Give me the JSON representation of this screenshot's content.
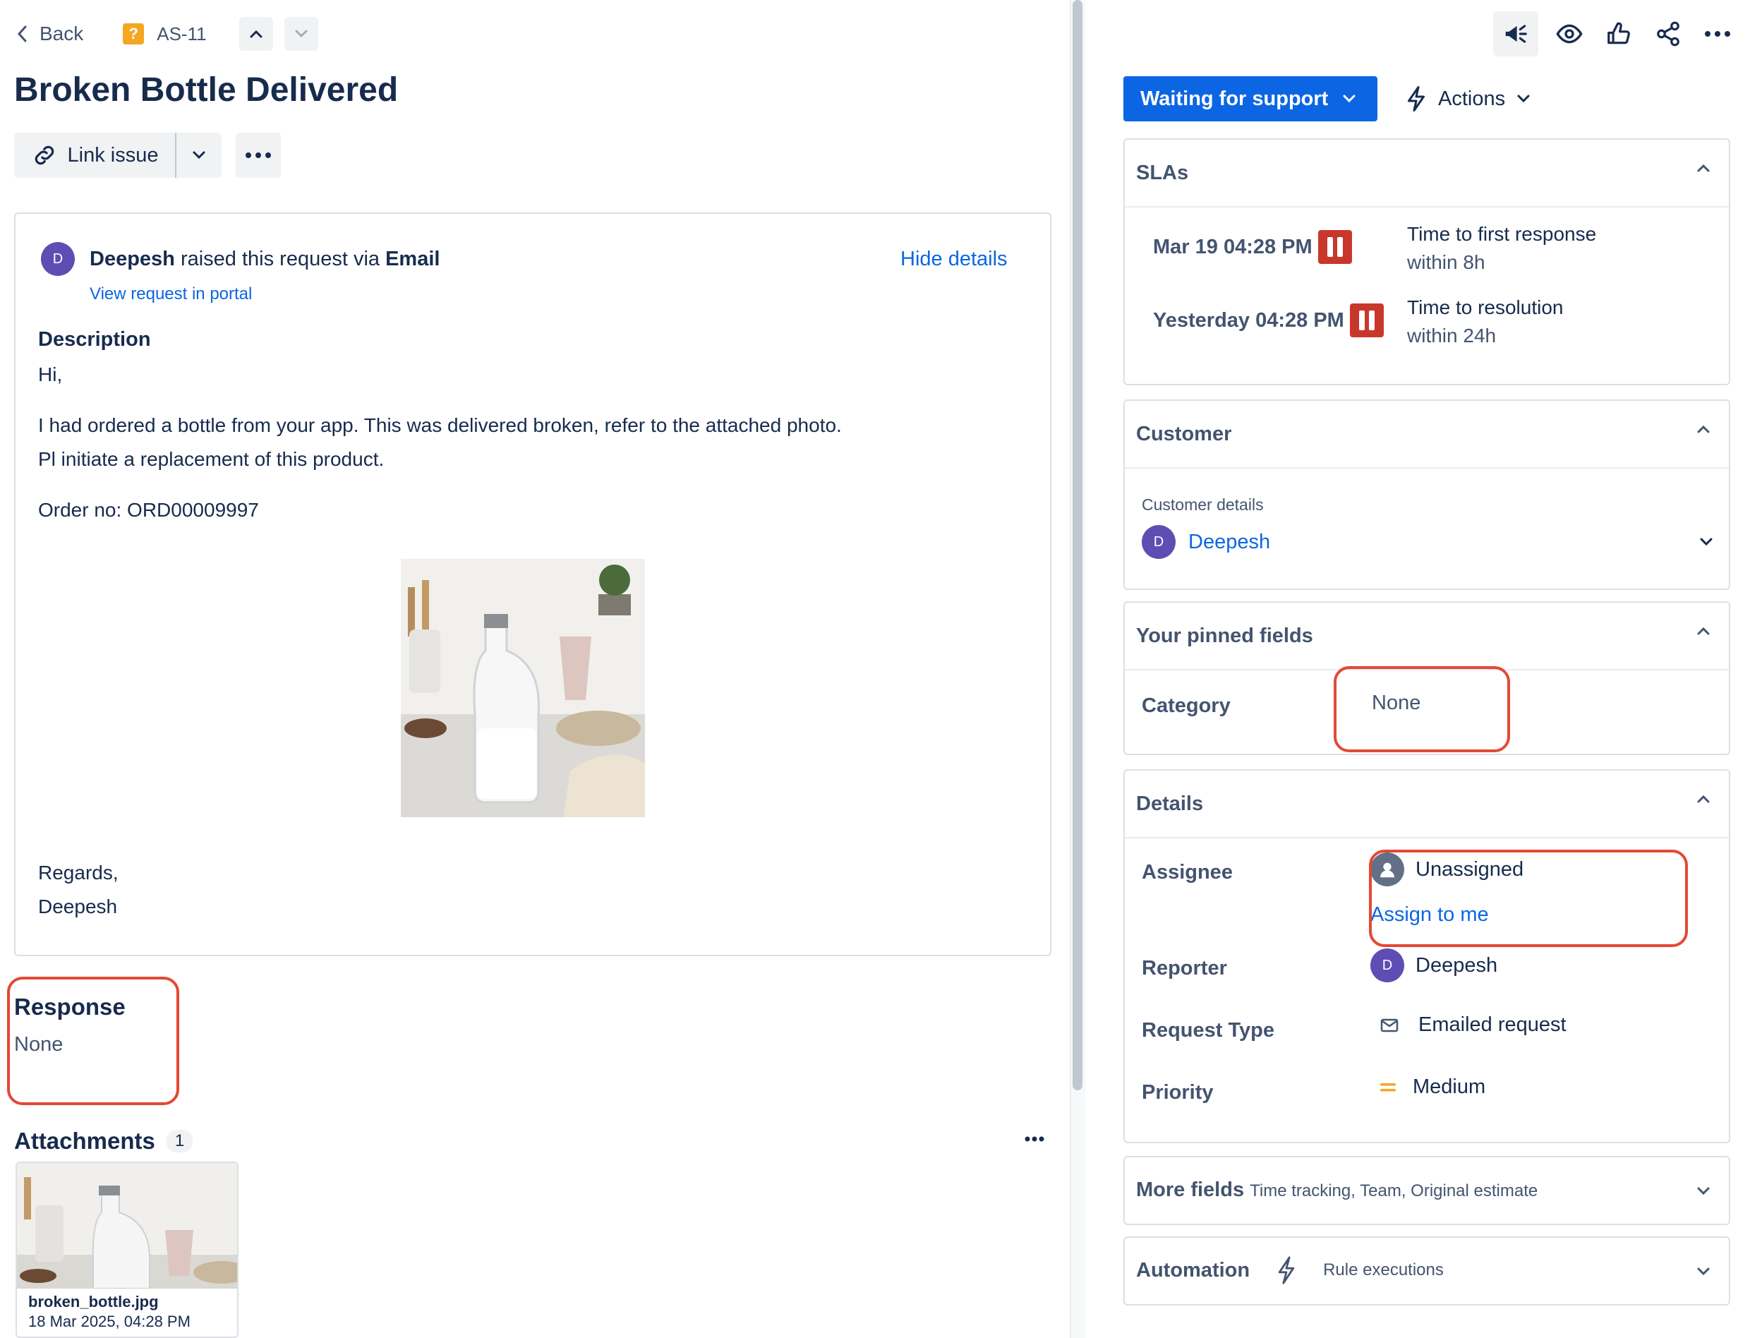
{
  "header": {
    "back_label": "Back",
    "issue_key": "AS-11"
  },
  "title": "Broken Bottle Delivered",
  "toolbar": {
    "link_issue_label": "Link issue"
  },
  "request": {
    "avatar_initial": "D",
    "raiser": "Deepesh",
    "raised_text": " raised this request via ",
    "channel": "Email",
    "hide_details": "Hide details",
    "view_portal": "View request in portal",
    "description_label": "Description",
    "lines": [
      "Hi,",
      "I had ordered a bottle from your app. This was delivered broken, refer to the attached photo.",
      "Pl initiate a replacement of this product.",
      "Order no: ORD00009997",
      "Regards,",
      "Deepesh"
    ]
  },
  "response": {
    "label": "Response",
    "value": "None"
  },
  "attachments": {
    "label": "Attachments",
    "count": "1",
    "items": [
      {
        "name": "broken_bottle.jpg",
        "date": "18 Mar 2025, 04:28 PM"
      }
    ]
  },
  "status": {
    "label": "Waiting for support",
    "actions_label": "Actions"
  },
  "slas": {
    "label": "SLAs",
    "items": [
      {
        "time": "Mar 19 04:28 PM",
        "name": "Time to first response",
        "target": "within 8h"
      },
      {
        "time": "Yesterday 04:28 PM",
        "name": "Time to resolution",
        "target": "within 24h"
      }
    ]
  },
  "customer": {
    "label": "Customer",
    "sublabel": "Customer details",
    "name": "Deepesh",
    "avatar_initial": "D"
  },
  "pinned": {
    "label": "Your pinned fields",
    "category_label": "Category",
    "category_value": "None"
  },
  "details": {
    "label": "Details",
    "assignee_label": "Assignee",
    "assignee_value": "Unassigned",
    "assign_to_me": "Assign to me",
    "reporter_label": "Reporter",
    "reporter_value": "Deepesh",
    "reporter_initial": "D",
    "request_type_label": "Request Type",
    "request_type_value": "Emailed request",
    "priority_label": "Priority",
    "priority_value": "Medium"
  },
  "more_fields": {
    "label": "More fields",
    "sub": "Time tracking, Team, Original estimate"
  },
  "automation": {
    "label": "Automation",
    "sub": "Rule executions"
  },
  "colors": {
    "accent": "#0c66e4",
    "highlight": "#e34935",
    "sla_paused": "#c9372c",
    "priority_medium": "#f5a623"
  },
  "icons": [
    "back-chevron-icon",
    "help-question-icon",
    "chevron-up-icon",
    "chevron-down-icon",
    "link-icon",
    "more-icon",
    "megaphone-icon",
    "eye-icon",
    "thumbs-up-icon",
    "share-icon",
    "lightning-icon",
    "pause-icon",
    "user-icon",
    "mail-icon",
    "priority-medium-icon"
  ]
}
